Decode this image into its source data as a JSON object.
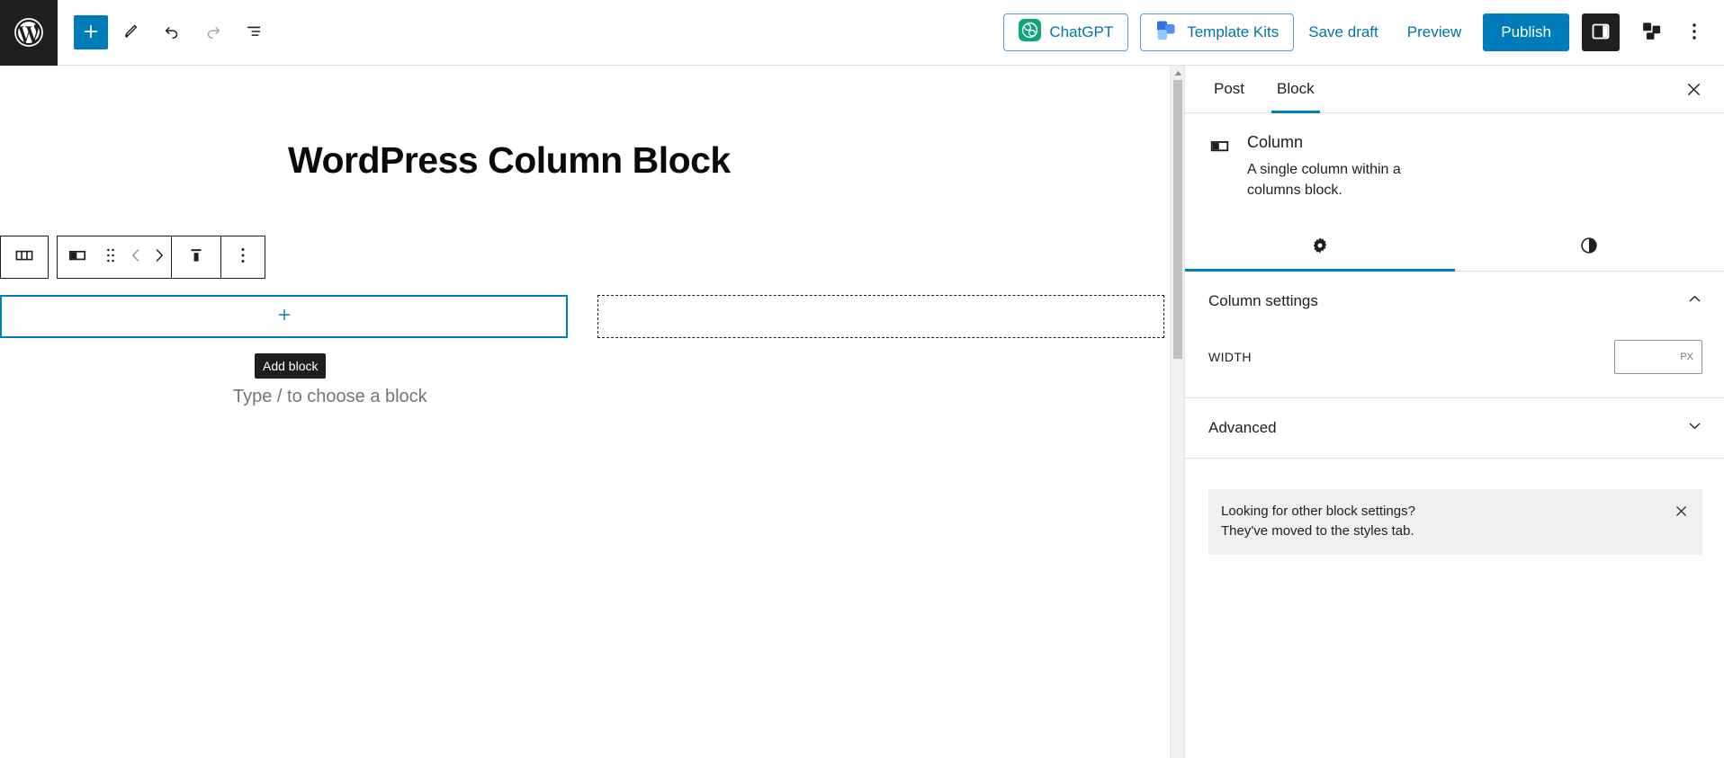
{
  "header": {
    "logo_icon": "wordpress-logo-icon",
    "tools": [
      {
        "name": "add-block-toggle",
        "icon": "plus-icon",
        "label": "Add block"
      },
      {
        "name": "edit-tool-toggle",
        "icon": "pencil-icon",
        "label": "Tools"
      },
      {
        "name": "undo-button",
        "icon": "undo-arrow-icon",
        "label": "Undo"
      },
      {
        "name": "redo-button",
        "icon": "redo-arrow-icon",
        "label": "Redo"
      },
      {
        "name": "document-overview-button",
        "icon": "list-view-icon",
        "label": "Document Overview"
      }
    ],
    "chatgpt_label": "ChatGPT",
    "template_kits_label": "Template Kits",
    "save_draft_label": "Save draft",
    "preview_label": "Preview",
    "publish_label": "Publish",
    "settings_toggle_icon": "sidebar-panel-icon",
    "blocks_icon": "block-patterns-icon",
    "more_icon": "vertical-ellipsis-icon",
    "accent_color": "#007cba",
    "link_color": "#0073aa"
  },
  "block_toolbar": {
    "parent_block_icon": "columns-icon",
    "items": [
      {
        "name": "block-type-button",
        "icon": "column-icon"
      },
      {
        "name": "drag-handle",
        "icon": "drag-dots-icon"
      },
      {
        "name": "move-left-button",
        "icon": "chevron-left-icon"
      },
      {
        "name": "move-right-button",
        "icon": "chevron-right-icon"
      },
      {
        "name": "vertical-align-button",
        "icon": "align-top-icon"
      },
      {
        "name": "block-options-button",
        "icon": "vertical-ellipsis-icon"
      }
    ]
  },
  "editor": {
    "post_title": "WordPress Column Block",
    "add_block_tooltip": "Add block",
    "paragraph_placeholder": "Type / to choose a block",
    "selected_border_color": "#007cba",
    "columns": [
      {
        "name": "column-block-selected",
        "state": "selected",
        "has_inserter": true
      },
      {
        "name": "column-block-empty",
        "state": "empty",
        "has_inserter": false
      }
    ]
  },
  "sidebar": {
    "tabs": [
      {
        "label": "Post",
        "active": false
      },
      {
        "label": "Block",
        "active": true
      }
    ],
    "close_icon": "close-icon",
    "block": {
      "icon": "column-icon",
      "title": "Column",
      "description": "A single column within a columns block."
    },
    "icon_tabs": [
      {
        "name": "settings-tab",
        "icon": "gear-icon",
        "active": true
      },
      {
        "name": "styles-tab",
        "icon": "contrast-half-circle-icon",
        "active": false
      }
    ],
    "panels": [
      {
        "name": "column-settings-panel",
        "title": "Column settings",
        "expanded": true,
        "chevron": "chevron-up-icon"
      },
      {
        "name": "advanced-panel",
        "title": "Advanced",
        "expanded": false,
        "chevron": "chevron-down-icon"
      }
    ],
    "width_field": {
      "label": "WIDTH",
      "value": "",
      "unit": "PX"
    },
    "notice": {
      "line1": "Looking for other block settings?",
      "line2": "They've moved to the styles tab.",
      "close_icon": "close-icon",
      "background": "#f0f0f0"
    }
  }
}
